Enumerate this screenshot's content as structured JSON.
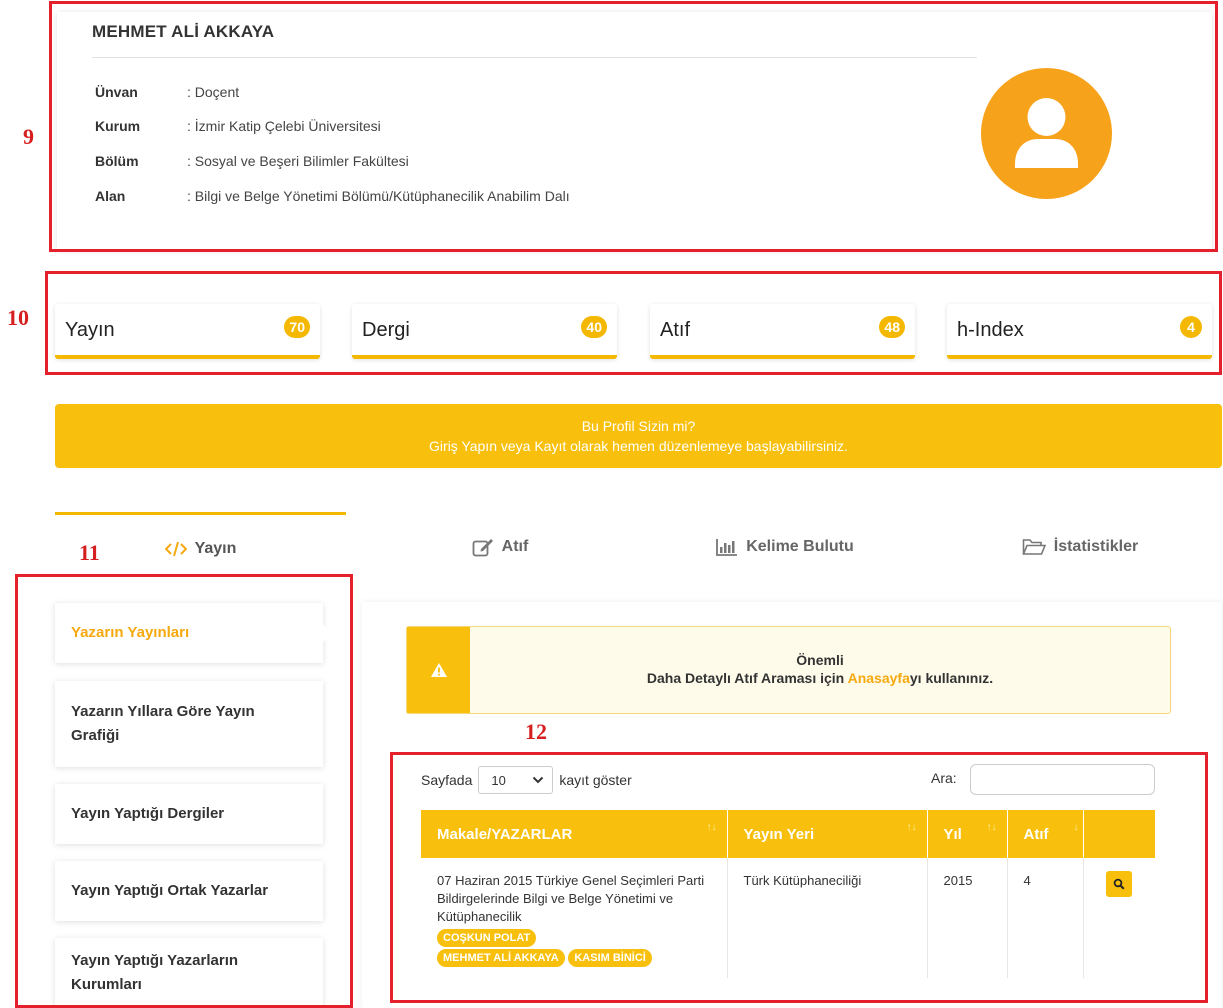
{
  "annotations": {
    "profile": "9",
    "stats": "10",
    "menu": "11",
    "table": "12"
  },
  "profile": {
    "name": "MEHMET ALİ AKKAYA",
    "fields": [
      {
        "label": "Ünvan",
        "value": ": Doçent"
      },
      {
        "label": "Kurum",
        "value": ": İzmir Katip Çelebi Üniversitesi"
      },
      {
        "label": "Bölüm",
        "value": ": Sosyal ve Beşeri Bilimler Fakültesi"
      },
      {
        "label": "Alan",
        "value": ": Bilgi ve Belge Yönetimi Bölümü/Kütüphanecilik Anabilim Dalı"
      }
    ],
    "avatar_icon": "user-icon",
    "avatar_color": "#f7a21b"
  },
  "stats": [
    {
      "label": "Yayın",
      "count": "70"
    },
    {
      "label": "Dergi",
      "count": "40"
    },
    {
      "label": "Atıf",
      "count": "48"
    },
    {
      "label": "h-Index",
      "count": "4"
    }
  ],
  "banner": {
    "line1": "Bu Profil Sizin mi?",
    "line2": "Giriş Yapın veya Kayıt olarak hemen düzenlemeye başlayabilirsiniz."
  },
  "tabs": [
    {
      "label": "Yayın",
      "icon": "code-icon",
      "active": true
    },
    {
      "label": "Atıf",
      "icon": "edit-icon",
      "active": false
    },
    {
      "label": "Kelime Bulutu",
      "icon": "bar-chart-icon",
      "active": false
    },
    {
      "label": "İstatistikler",
      "icon": "folder-open-icon",
      "active": false
    }
  ],
  "side_menu": [
    {
      "label": "Yazarın Yayınları",
      "active": true
    },
    {
      "label": "Yazarın Yıllara Göre Yayın Grafiği",
      "active": false
    },
    {
      "label": "Yayın Yaptığı Dergiler",
      "active": false
    },
    {
      "label": "Yayın Yaptığı Ortak Yazarlar",
      "active": false
    },
    {
      "label": "Yayın Yaptığı Yazarların Kurumları",
      "active": false
    }
  ],
  "alert": {
    "title": "Önemli",
    "text_before": "Daha Detaylı Atıf Araması için ",
    "link": "Anasayfa",
    "text_after": "yı kullanınız.",
    "icon": "warning-icon"
  },
  "table_controls": {
    "show_prefix": "Sayfada",
    "page_size": "10",
    "show_suffix": "kayıt göster",
    "search_label": "Ara:"
  },
  "table": {
    "headers": [
      "Makale/YAZARLAR",
      "Yayın Yeri",
      "Yıl",
      "Atıf",
      ""
    ],
    "rows": [
      {
        "title": "07 Haziran 2015 Türkiye Genel Seçimleri Parti Bildirgelerinde Bilgi ve Belge Yönetimi ve Kütüphanecilik",
        "authors": [
          "COŞKUN POLAT",
          "MEHMET ALİ AKKAYA",
          "KASIM BİNİCİ"
        ],
        "venue": "Türk Kütüphaneciliği",
        "year": "2015",
        "citations": "4"
      }
    ]
  },
  "colors": {
    "accent": "#f8c00c",
    "annotation": "#e3202b",
    "active_menu": "#f5a90e"
  }
}
